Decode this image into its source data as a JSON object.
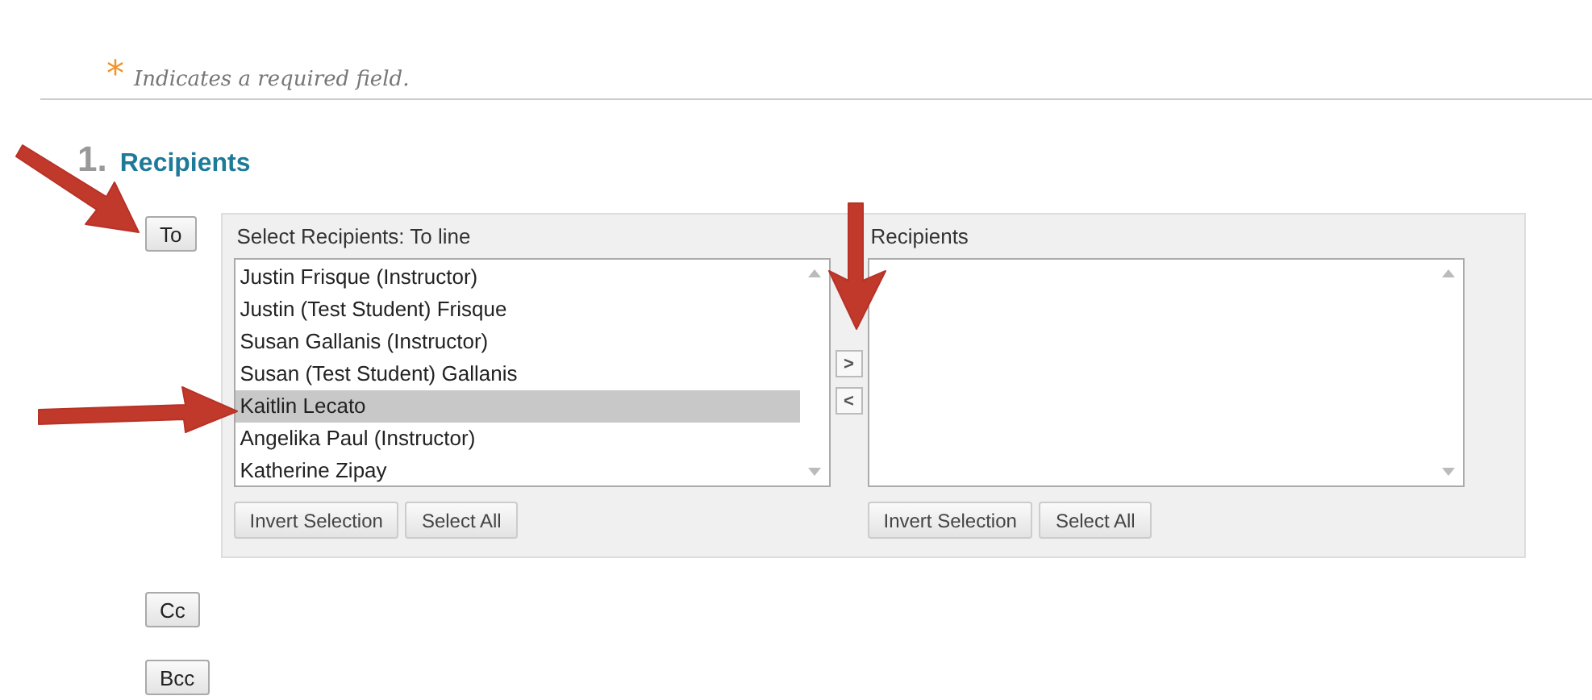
{
  "note": {
    "marker": "*",
    "text": "Indicates a required field."
  },
  "section": {
    "number": "1.",
    "title": "Recipients"
  },
  "to_button": "To",
  "source": {
    "label": "Select Recipients: To line",
    "items": [
      {
        "name": "Justin Frisque (Instructor)",
        "selected": false
      },
      {
        "name": "Justin (Test Student) Frisque",
        "selected": false
      },
      {
        "name": "Susan Gallanis (Instructor)",
        "selected": false
      },
      {
        "name": "Susan (Test Student) Gallanis",
        "selected": false
      },
      {
        "name": "Kaitlin Lecato",
        "selected": true
      },
      {
        "name": "Angelika Paul (Instructor)",
        "selected": false
      },
      {
        "name": "Katherine Zipay",
        "selected": false
      }
    ],
    "buttons": [
      "Invert Selection",
      "Select All"
    ]
  },
  "move_buttons": [
    ">",
    "<"
  ],
  "target": {
    "label": "Recipients",
    "buttons": [
      "Invert Selection",
      "Select All"
    ]
  },
  "cc_button": "Cc",
  "bcc_button": "Bcc"
}
